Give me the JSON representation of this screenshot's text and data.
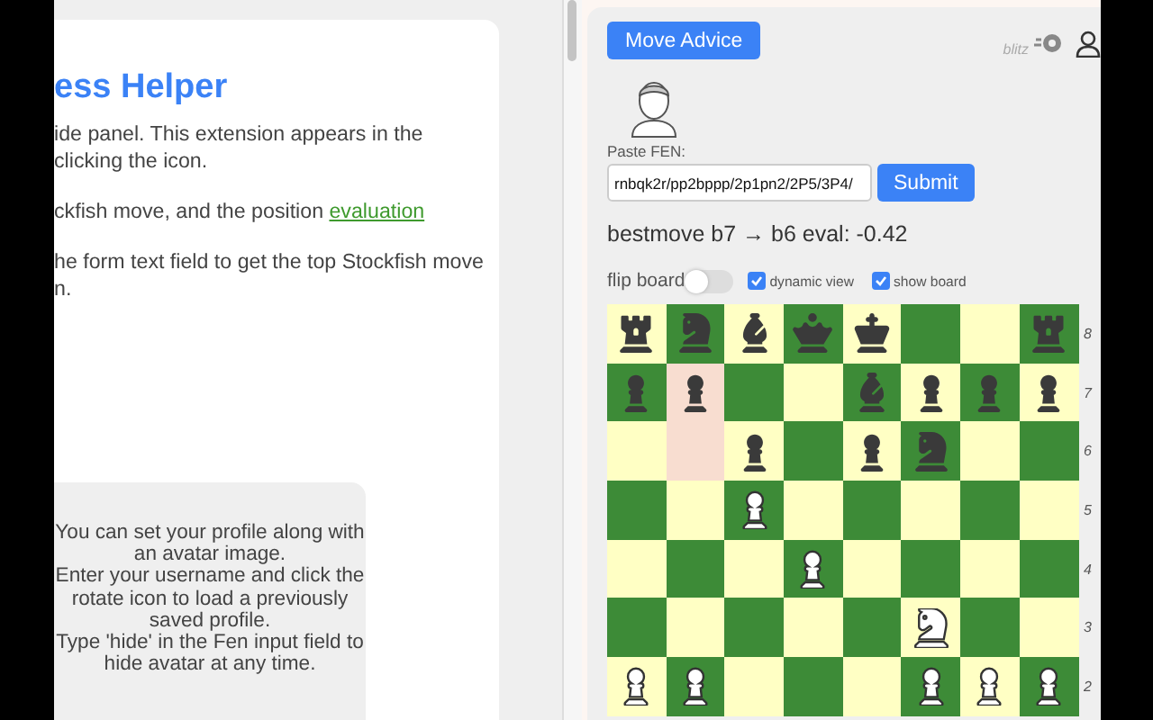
{
  "help_card": {
    "title": "ess Helper",
    "paragraphs": [
      {
        "lines": [
          "ide panel. This extension appears in the",
          "clicking the icon."
        ]
      },
      {
        "lines": [
          "ckfish move, and the position "
        ],
        "link": "evaluation"
      },
      {
        "lines": [
          "he form text field to get the top Stockfish move",
          "n."
        ]
      }
    ],
    "profile_note": [
      "You can set your profile along with",
      "an avatar image.",
      "Enter your username and click the",
      "rotate icon to load a previously",
      "saved profile.",
      "Type 'hide' in the Fen input field to",
      "hide avatar at any time."
    ]
  },
  "panel": {
    "advice_button": "Move Advice",
    "mode_label": "blitz",
    "fen": {
      "label": "Paste FEN:",
      "value": "rnbqk2r/pp2bppp/2p1pn2/2P5/3P4/",
      "button": "Submit"
    },
    "result": "bestmove b7 → b6 eval: -0.42",
    "flip": {
      "label": "flip board",
      "on": false
    },
    "options": [
      {
        "label": "dynamic view",
        "checked": true
      },
      {
        "label": "show board",
        "checked": true
      }
    ],
    "board": {
      "ranks": [
        {
          "label": "8",
          "squares": [
            {
              "kind": "rook",
              "white": false,
              "highlighted": false
            },
            {
              "kind": "knight",
              "white": false,
              "highlighted": false
            },
            {
              "kind": "bishop",
              "white": false,
              "highlighted": false
            },
            {
              "kind": "queen",
              "white": false,
              "highlighted": false
            },
            {
              "kind": "king",
              "white": false,
              "highlighted": false
            },
            {
              "kind": "empty",
              "highlighted": false
            },
            {
              "kind": "empty",
              "highlighted": false
            },
            {
              "kind": "rook",
              "white": false,
              "highlighted": false
            }
          ]
        },
        {
          "label": "7",
          "squares": [
            {
              "kind": "pawn",
              "white": false,
              "highlighted": false
            },
            {
              "kind": "pawn",
              "white": false,
              "highlighted": true
            },
            {
              "kind": "empty",
              "highlighted": false
            },
            {
              "kind": "empty",
              "highlighted": false
            },
            {
              "kind": "bishop",
              "white": false,
              "highlighted": false
            },
            {
              "kind": "pawn",
              "white": false,
              "highlighted": false
            },
            {
              "kind": "pawn",
              "white": false,
              "highlighted": false
            },
            {
              "kind": "pawn",
              "white": false,
              "highlighted": false
            }
          ]
        },
        {
          "label": "6",
          "squares": [
            {
              "kind": "empty",
              "highlighted": false
            },
            {
              "kind": "empty",
              "highlighted": true
            },
            {
              "kind": "pawn",
              "white": false,
              "highlighted": false
            },
            {
              "kind": "empty",
              "highlighted": false
            },
            {
              "kind": "pawn",
              "white": false,
              "highlighted": false
            },
            {
              "kind": "knight",
              "white": false,
              "highlighted": false
            },
            {
              "kind": "empty",
              "highlighted": false
            },
            {
              "kind": "empty",
              "highlighted": false
            }
          ]
        },
        {
          "label": "5",
          "squares": [
            {
              "kind": "empty",
              "highlighted": false
            },
            {
              "kind": "empty",
              "highlighted": false
            },
            {
              "kind": "pawn",
              "white": true,
              "highlighted": false
            },
            {
              "kind": "empty",
              "highlighted": false
            },
            {
              "kind": "empty",
              "highlighted": false
            },
            {
              "kind": "empty",
              "highlighted": false
            },
            {
              "kind": "empty",
              "highlighted": false
            },
            {
              "kind": "empty",
              "highlighted": false
            }
          ]
        },
        {
          "label": "4",
          "squares": [
            {
              "kind": "empty",
              "highlighted": false
            },
            {
              "kind": "empty",
              "highlighted": false
            },
            {
              "kind": "empty",
              "highlighted": false
            },
            {
              "kind": "pawn",
              "white": true,
              "highlighted": false
            },
            {
              "kind": "empty",
              "highlighted": false
            },
            {
              "kind": "empty",
              "highlighted": false
            },
            {
              "kind": "empty",
              "highlighted": false
            },
            {
              "kind": "empty",
              "highlighted": false
            }
          ]
        },
        {
          "label": "3",
          "squares": [
            {
              "kind": "empty",
              "highlighted": false
            },
            {
              "kind": "empty",
              "highlighted": false
            },
            {
              "kind": "empty",
              "highlighted": false
            },
            {
              "kind": "empty",
              "highlighted": false
            },
            {
              "kind": "empty",
              "highlighted": false
            },
            {
              "kind": "knight",
              "white": true,
              "highlighted": false
            },
            {
              "kind": "empty",
              "highlighted": false
            },
            {
              "kind": "empty",
              "highlighted": false
            }
          ]
        },
        {
          "label": "2",
          "squares": [
            {
              "kind": "pawn",
              "white": true,
              "highlighted": false
            },
            {
              "kind": "pawn",
              "white": true,
              "highlighted": false
            },
            {
              "kind": "empty",
              "highlighted": false
            },
            {
              "kind": "empty",
              "highlighted": false
            },
            {
              "kind": "empty",
              "highlighted": false
            },
            {
              "kind": "pawn",
              "white": true,
              "highlighted": false
            },
            {
              "kind": "pawn",
              "white": true,
              "highlighted": false
            },
            {
              "kind": "pawn",
              "white": true,
              "highlighted": false
            }
          ]
        }
      ]
    }
  }
}
